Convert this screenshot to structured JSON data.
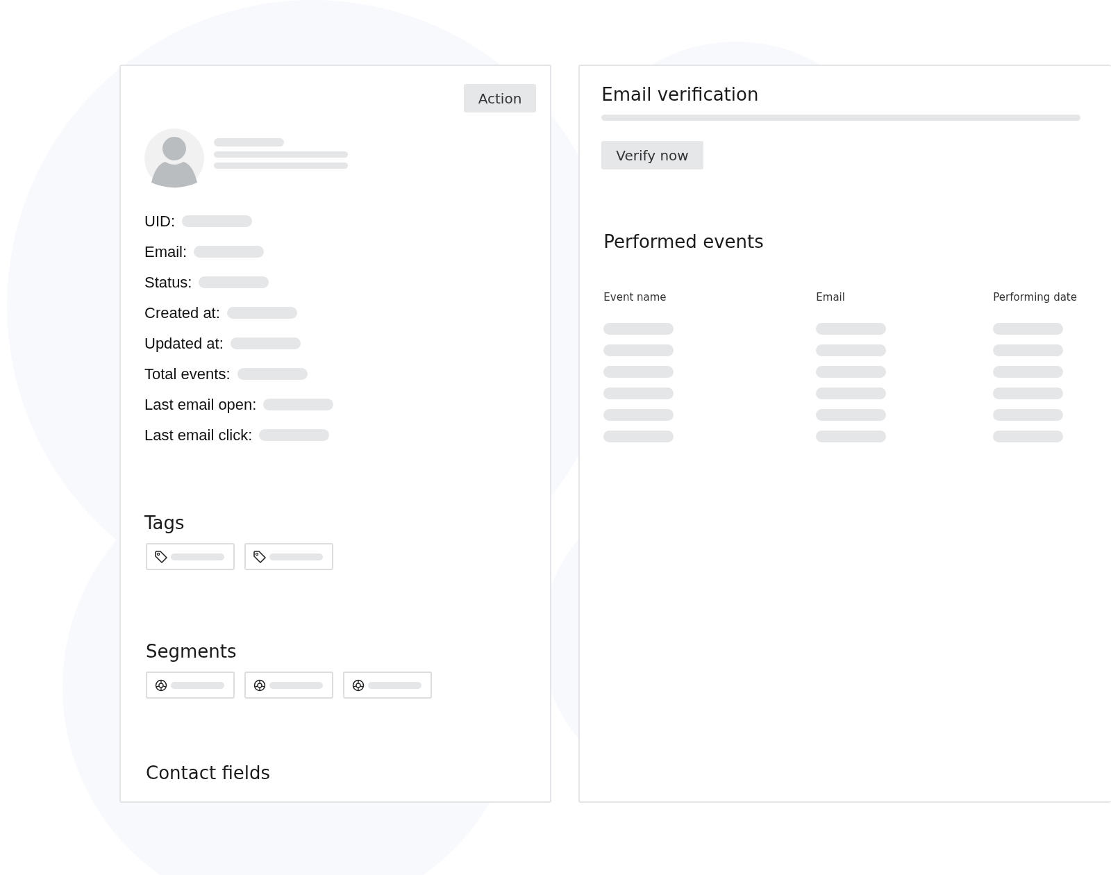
{
  "contact_card": {
    "action_button": "Action",
    "fields": [
      {
        "label": "UID:"
      },
      {
        "label": "Email:"
      },
      {
        "label": "Status:"
      },
      {
        "label": "Created at:"
      },
      {
        "label": "Updated at:"
      },
      {
        "label": "Total events:"
      },
      {
        "label": "Last email open:"
      },
      {
        "label": "Last email click:"
      }
    ],
    "tags": {
      "title": "Tags",
      "items": [
        {
          "kind": "placeholder"
        },
        {
          "kind": "placeholder"
        }
      ]
    },
    "segments": {
      "title": "Segments",
      "items": [
        {
          "kind": "placeholder"
        },
        {
          "kind": "placeholder"
        },
        {
          "kind": "placeholder"
        }
      ]
    },
    "contact_fields": {
      "title": "Contact fields"
    }
  },
  "verification_card": {
    "title": "Email verification",
    "button": "Verify now"
  },
  "events": {
    "title": "Performed events",
    "columns": [
      "Event name",
      "Email",
      "Performing date"
    ],
    "rows": [
      {
        "kind": "placeholder"
      },
      {
        "kind": "placeholder"
      },
      {
        "kind": "placeholder"
      },
      {
        "kind": "placeholder"
      },
      {
        "kind": "placeholder"
      },
      {
        "kind": "placeholder"
      }
    ]
  }
}
